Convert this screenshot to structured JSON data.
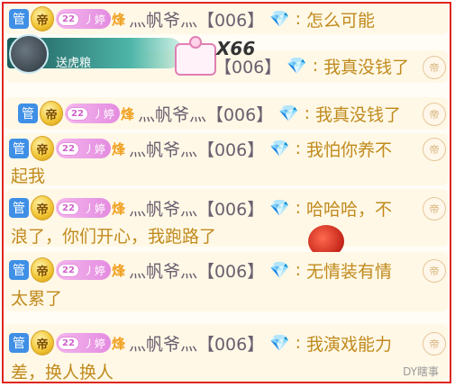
{
  "colors": {
    "frame": "#e0261d",
    "guan_badge": "#3f8fe6",
    "fan_badge": "#e48ce0",
    "message": "#c08a1d",
    "nick": "#6a5f6f"
  },
  "icons": {
    "guan": "admin-badge",
    "medal": "emperor-medal",
    "gem": "diamond-icon",
    "bubble": "fan-bubble-icon"
  },
  "common": {
    "guan_label": "管",
    "medal_label": "帝",
    "fan_level": "22",
    "fan_name": "丿婷",
    "fan_flag": "烽",
    "nickname": "灬帆爷灬【006】",
    "gem_symbol": "💎",
    "colon": ":",
    "bubble_label": "帝"
  },
  "gift": {
    "text": "送虎粮",
    "count": "X66"
  },
  "messages": [
    {
      "line1": "怎么可能",
      "line2": ""
    },
    {
      "line1": "我真没钱了",
      "line2": ""
    },
    {
      "line1": "我真没钱了",
      "line2": ""
    },
    {
      "line1": "我怕你养不",
      "line2": "起我"
    },
    {
      "line1": "哈哈哈，不",
      "line2": "浪了，你们开心，我跑路了"
    },
    {
      "line1": "无情装有情",
      "line2": "太累了"
    },
    {
      "line1": "我演戏能力",
      "line2": "差，换人换人"
    }
  ],
  "watermark": "DY瞎事"
}
